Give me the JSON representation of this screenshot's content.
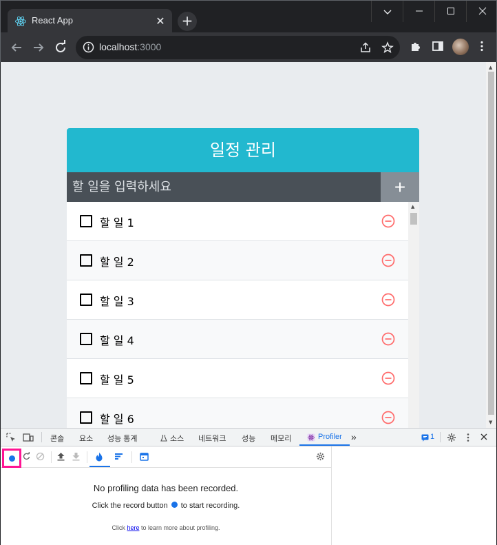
{
  "browser": {
    "tab_title": "React App",
    "url_host": "localhost",
    "url_port": ":3000"
  },
  "app": {
    "title": "일정 관리",
    "input_placeholder": "할 일을 입력하세요",
    "add_label": "+",
    "todos": [
      {
        "text": "할 일 1",
        "checked": false
      },
      {
        "text": "할 일 2",
        "checked": false
      },
      {
        "text": "할 일 3",
        "checked": false
      },
      {
        "text": "할 일 4",
        "checked": false
      },
      {
        "text": "할 일 5",
        "checked": false
      },
      {
        "text": "할 일 6",
        "checked": false
      }
    ],
    "colors": {
      "header": "#22b8cf",
      "form": "#495057",
      "add_button": "#868e96",
      "remove_icon": "#ff6b6b"
    }
  },
  "devtools": {
    "tabs": [
      "콘솔",
      "요소",
      "성능 통계",
      "소스",
      "네트워크",
      "성능",
      "메모리",
      "Profiler"
    ],
    "active_tab": "Profiler",
    "more_tabs": "»",
    "issues_count": "1",
    "profiler": {
      "empty_title": "No profiling data has been recorded.",
      "hint_before": "Click the record button",
      "hint_after": "to start recording.",
      "learn_before": "Click",
      "learn_link": "here",
      "learn_after": "to learn more about profiling."
    }
  }
}
